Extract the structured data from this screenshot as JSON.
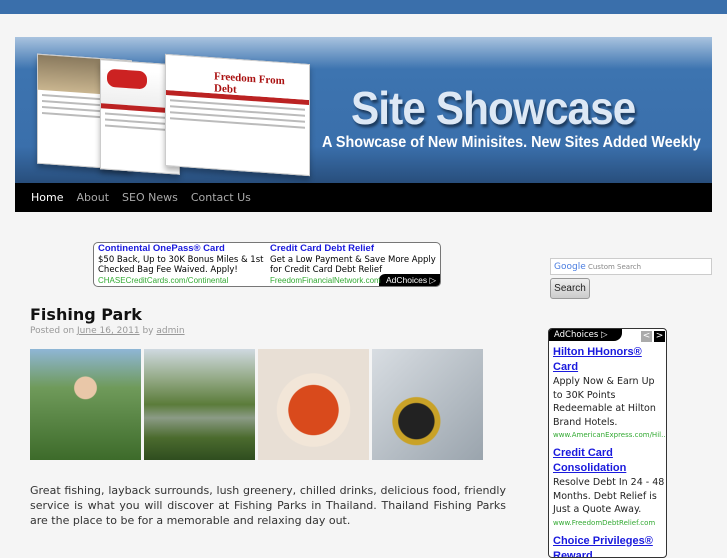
{
  "header": {
    "title": "Site Showcase",
    "tagline": "A Showcase of New Minisites. New Sites Added Weekly",
    "mock_text": "Freedom From Debt"
  },
  "nav": [
    {
      "label": "Home"
    },
    {
      "label": "About"
    },
    {
      "label": "SEO News"
    },
    {
      "label": "Contact Us"
    }
  ],
  "top_ad": {
    "items": [
      {
        "title": "Continental OnePass® Card",
        "desc": "$50 Back, Up to 30K Bonus Miles & 1st Checked Bag Fee Waived. Apply!",
        "url": "CHASECreditCards.com/Continental"
      },
      {
        "title": "Credit Card Debt Relief",
        "desc": "Get a Low Payment & Save More Apply for Credit Card Debt Relief",
        "url": "FreedomFinancialNetwork.com"
      }
    ],
    "adchoices": "AdChoices"
  },
  "post": {
    "title": "Fishing Park",
    "posted_on": "Posted on",
    "date": "June 16, 2011",
    "by": "by",
    "author": "admin",
    "images": [
      "woman-with-drink-photo",
      "river-photo",
      "soup-photo",
      "fishing-reel-photo"
    ],
    "body": "Great fishing, layback surrounds, lush greenery, chilled drinks, delicious food, friendly service is what you will discover at Fishing Parks in Thailand. Thailand Fishing Parks are the place to be for a memorable and relaxing day out."
  },
  "search": {
    "google": "Google",
    "placeholder": "Custom Search",
    "button": "Search"
  },
  "side_ad": {
    "adchoices": "AdChoices",
    "prev": "<",
    "next": ">",
    "items": [
      {
        "title": "Hilton HHonors® Card",
        "desc": "Apply Now & Earn Up to 30K Points Redeemable at Hilton Brand Hotels.",
        "url": "www.AmericanExpress.com/Hil..."
      },
      {
        "title": "Credit Card Consolidation",
        "desc": "Resolve Debt In 24 - 48 Months. Debt Relief is Just a Quote Away.",
        "url": "www.FreedomDebtRelief.com"
      },
      {
        "title": "Choice Privileges® Reward",
        "desc": "",
        "url": ""
      }
    ]
  },
  "colors": {
    "accent": "#3a6fab",
    "ad_link": "#1a1add",
    "ad_url": "#33aa33"
  }
}
